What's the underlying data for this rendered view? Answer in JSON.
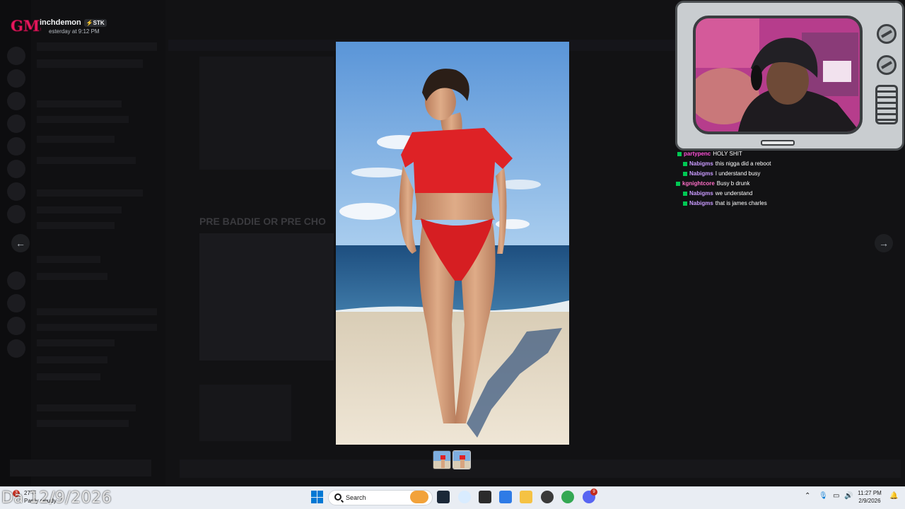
{
  "poster": {
    "name": "inchdemon",
    "tag": "STK",
    "time": "esterday at 9:12 PM"
  },
  "background": {
    "message_title": "PRE BADDIE OR PRE CHO"
  },
  "viewer": {
    "prev_label": "←",
    "next_label": "→",
    "thumbnail_count": 2
  },
  "chat": {
    "messages": [
      {
        "user": "partypenc",
        "text": "HOLY SHIT",
        "color": "#ff4fd8"
      },
      {
        "user": "Nabigms",
        "text": "this nigga did a reboot",
        "color": "#c99bff"
      },
      {
        "user": "Nabigms",
        "text": "I understand busy",
        "color": "#c99bff"
      },
      {
        "user": "kgnightcore",
        "text": "Busy b drunk",
        "color": "#ff6ec7"
      },
      {
        "user": "Nabigms",
        "text": "we understand",
        "color": "#c99bff"
      },
      {
        "user": "Nabigms",
        "text": "that is james charles",
        "color": "#c99bff"
      }
    ]
  },
  "overlay": {
    "date_text": "Da 12/9/2026"
  },
  "taskbar": {
    "weather_temp": "27°F",
    "weather_condition": "Partly cloudy",
    "weather_badge": "3",
    "search_placeholder": "Search",
    "time": "11:27 PM",
    "date": "2/9/2026",
    "discord_badge": "9"
  }
}
